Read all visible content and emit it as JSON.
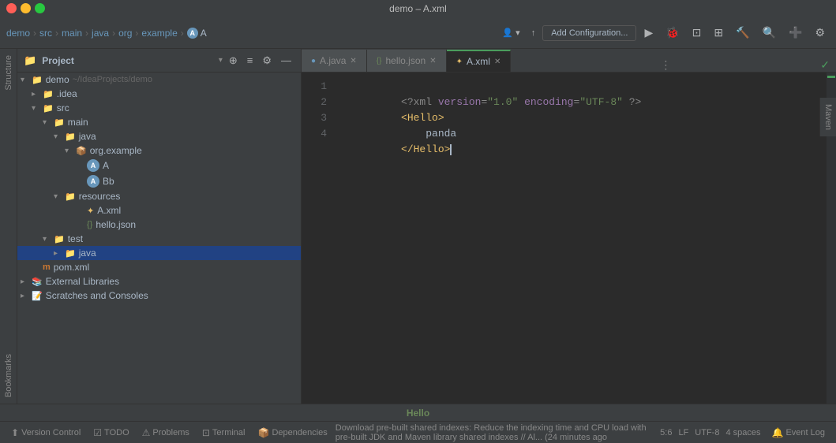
{
  "titleBar": {
    "title": "demo – A.xml"
  },
  "breadcrumb": {
    "items": [
      "demo",
      "src",
      "main",
      "java",
      "org",
      "example",
      "A"
    ]
  },
  "toolbar": {
    "configLabel": "Add Configuration...",
    "userIcon": "👤",
    "arrowIcon": "↑",
    "searchIcon": "🔍",
    "plusIcon": "+",
    "settingsIcon": "⚙"
  },
  "projectPanel": {
    "title": "Project",
    "collapseAllIcon": "≡",
    "expandIcon": "⊕",
    "settingsIcon": "⚙",
    "closeIcon": "—"
  },
  "fileTree": [
    {
      "indent": 0,
      "type": "folder",
      "name": "demo",
      "extra": "~/IdeaProjects/demo",
      "expanded": true,
      "icon": "▾"
    },
    {
      "indent": 1,
      "type": "folder",
      "name": ".idea",
      "expanded": false,
      "icon": "▸"
    },
    {
      "indent": 1,
      "type": "folder",
      "name": "src",
      "expanded": true,
      "icon": "▾"
    },
    {
      "indent": 2,
      "type": "folder",
      "name": "main",
      "expanded": true,
      "icon": "▾"
    },
    {
      "indent": 3,
      "type": "folder",
      "name": "java",
      "expanded": true,
      "icon": "▾"
    },
    {
      "indent": 4,
      "type": "package",
      "name": "org.example",
      "expanded": true,
      "icon": "▾"
    },
    {
      "indent": 5,
      "type": "class",
      "name": "A",
      "icon": "A"
    },
    {
      "indent": 5,
      "type": "class",
      "name": "Bb",
      "icon": "A"
    },
    {
      "indent": 3,
      "type": "folder",
      "name": "resources",
      "expanded": true,
      "icon": "▾"
    },
    {
      "indent": 4,
      "type": "xml",
      "name": "A.xml",
      "icon": "✦"
    },
    {
      "indent": 4,
      "type": "json",
      "name": "hello.json",
      "icon": "{}"
    },
    {
      "indent": 2,
      "type": "folder",
      "name": "test",
      "expanded": true,
      "icon": "▾"
    },
    {
      "indent": 3,
      "type": "folder",
      "name": "java",
      "expanded": false,
      "icon": "▸",
      "selected": true
    },
    {
      "indent": 1,
      "type": "pom",
      "name": "pom.xml",
      "icon": "m"
    },
    {
      "indent": 0,
      "type": "folder-ext",
      "name": "External Libraries",
      "expanded": false,
      "icon": "▸"
    },
    {
      "indent": 0,
      "type": "folder-scratch",
      "name": "Scratches and Consoles",
      "expanded": false,
      "icon": "▸"
    }
  ],
  "tabs": [
    {
      "name": "A.java",
      "type": "java",
      "active": false,
      "modified": false
    },
    {
      "name": "hello.json",
      "type": "json",
      "active": false,
      "modified": false
    },
    {
      "name": "A.xml",
      "type": "xml",
      "active": true,
      "modified": false
    }
  ],
  "editor": {
    "lines": [
      {
        "num": 1,
        "code": "xml_prolog"
      },
      {
        "num": 2,
        "code": "hello_open"
      },
      {
        "num": 3,
        "code": "panda_text"
      },
      {
        "num": 4,
        "code": "hello_close"
      }
    ],
    "codeLines": [
      "<?xml version=\"1.0\" encoding=\"UTF-8\" ?>",
      "<Hello>",
      "    panda",
      "</Hello>"
    ]
  },
  "statusWord": "Hello",
  "bottomBar": {
    "versionControl": "Version Control",
    "todo": "TODO",
    "problems": "Problems",
    "terminal": "Terminal",
    "dependencies": "Dependencies",
    "eventLog": "Event Log",
    "statusMsg": "Download pre-built shared indexes: Reduce the indexing time and CPU load with pre-built JDK and Maven library shared indexes // Al... (24 minutes ago",
    "position": "5:6",
    "lineEnding": "LF",
    "encoding": "UTF-8",
    "indent": "4 spaces"
  },
  "sideButtons": [
    "Structure",
    "Bookmarks"
  ],
  "mavenTab": "Maven",
  "checkMark": "✓"
}
